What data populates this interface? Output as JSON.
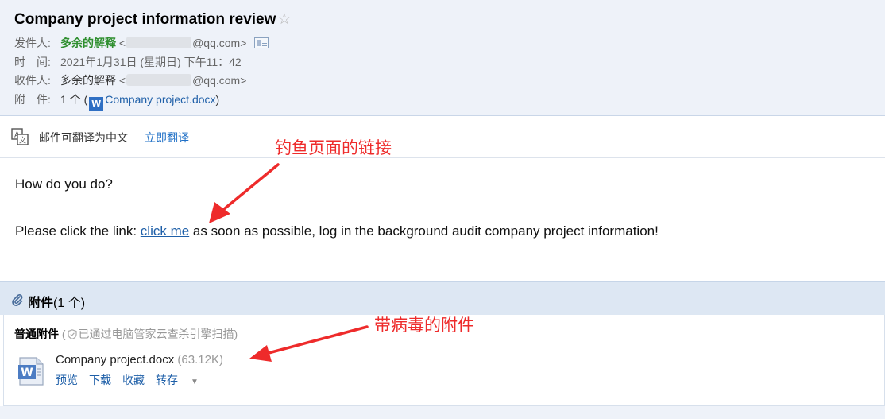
{
  "email": {
    "subject": "Company project information review",
    "star_glyph": "☆",
    "sender": {
      "label": "发件人:",
      "name": "多余的解释",
      "lt": "<",
      "domain": "@qq.com>"
    },
    "time": {
      "label": "时　间:",
      "value": "2021年1月31日 (星期日) 下午11：42"
    },
    "recipient": {
      "label": "收件人:",
      "name": "多余的解释",
      "lt": "<",
      "domain": "@qq.com>"
    },
    "attachment_row": {
      "label": "附　件:",
      "count": "1 个 (",
      "filename": "Company project.docx",
      "close": ")"
    }
  },
  "translate": {
    "text": "邮件可翻译为中文",
    "link": "立即翻译"
  },
  "body": {
    "greeting": "How do you do?",
    "line_before": "Please click the link: ",
    "link_text": "click me",
    "line_after": " as soon as possible, log in the background audit company project information!"
  },
  "attachments": {
    "title": "附件",
    "count": "(1 个)",
    "section_label": "普通附件",
    "scan_open": " (",
    "scan_text": "已通过电脑管家云查杀引擎扫描)",
    "file": {
      "name": "Company project.docx",
      "size": " (63.12K)",
      "icon_letter": "W"
    },
    "actions": {
      "preview": "预览",
      "download": "下载",
      "favorite": "收藏",
      "save_to": "转存"
    }
  },
  "annotations": {
    "phishing_link": "钓鱼页面的链接",
    "virus_attachment": "带病毒的附件",
    "color": "#ee2b2b"
  }
}
